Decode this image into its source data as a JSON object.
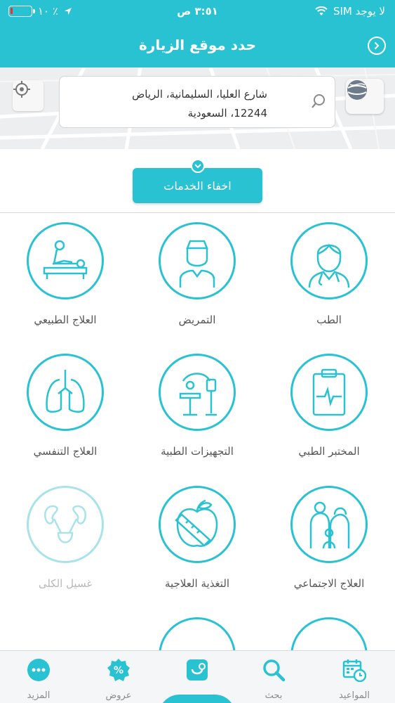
{
  "status": {
    "carrier": "لا يوجد SIM",
    "time": "٣:٥١ ص",
    "battery_text": "١٠ ٪",
    "battery_level": 0.1
  },
  "header": {
    "title": "حدد موقع الزيارة",
    "back_icon": "chevron-right-circle-icon"
  },
  "map": {
    "address_line1": "شارع العليا، السليمانية، الرياض",
    "address_line2": "12244، السعودية"
  },
  "hide_services_label": "اخفاء الخدمات",
  "services": [
    {
      "label": "الطب",
      "icon": "doctor-icon",
      "enabled": true
    },
    {
      "label": "التمريض",
      "icon": "nurse-icon",
      "enabled": true
    },
    {
      "label": "العلاج الطبيعي",
      "icon": "physiotherapy-icon",
      "enabled": true
    },
    {
      "label": "المختبر الطبي",
      "icon": "lab-clipboard-icon",
      "enabled": true
    },
    {
      "label": "التجهيزات الطبية",
      "icon": "medical-equipment-icon",
      "enabled": true
    },
    {
      "label": "العلاج التنفسي",
      "icon": "lungs-icon",
      "enabled": true
    },
    {
      "label": "العلاج الاجتماعي",
      "icon": "family-icon",
      "enabled": true
    },
    {
      "label": "التغذية العلاجية",
      "icon": "apple-tape-icon",
      "enabled": true
    },
    {
      "label": "غسيل الكلى",
      "icon": "kidneys-icon",
      "enabled": false
    }
  ],
  "tabs": [
    {
      "label": "المواعيد",
      "icon": "calendar-clock-icon"
    },
    {
      "label": "بحث",
      "icon": "search-icon"
    },
    {
      "label": "",
      "icon": "home-heart-icon"
    },
    {
      "label": "عروض",
      "icon": "percent-badge-icon"
    },
    {
      "label": "المزيد",
      "icon": "more-dots-icon"
    }
  ],
  "colors": {
    "primary": "#29c2d2",
    "battery_low": "#e7333b"
  }
}
